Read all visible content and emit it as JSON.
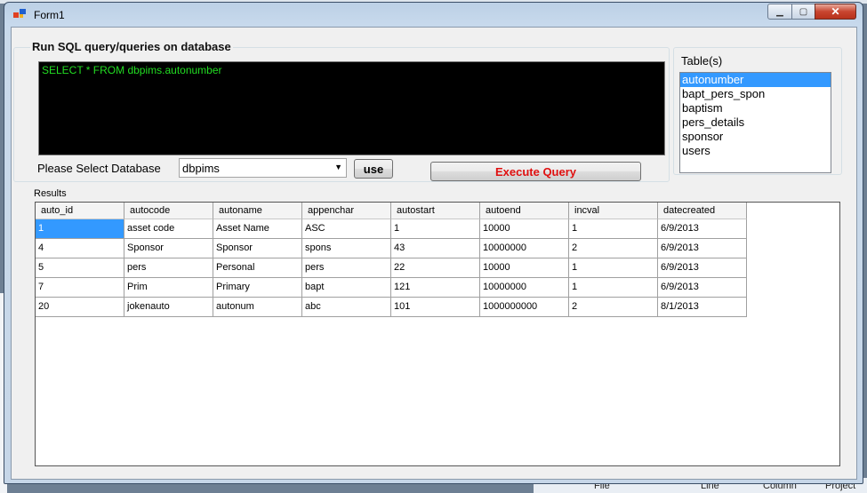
{
  "window": {
    "title": "Form1"
  },
  "sql": {
    "group_title": "Run SQL query/queries on database",
    "query_text": "SELECT * FROM dbpims.autonumber"
  },
  "database": {
    "label": "Please Select Database",
    "selected": "dbpims",
    "use_label": "use"
  },
  "execute_label": "Execute Query",
  "tables": {
    "title": "Table(s)",
    "items": [
      "autonumber",
      "bapt_pers_spon",
      "baptism",
      "pers_details",
      "sponsor",
      "users"
    ],
    "selected_index": 0
  },
  "results": {
    "title": "Results",
    "columns": [
      "auto_id",
      "autocode",
      "autoname",
      "appenchar",
      "autostart",
      "autoend",
      "incval",
      "datecreated"
    ],
    "rows": [
      [
        "1",
        "asset code",
        "Asset Name",
        "ASC",
        "1",
        "10000",
        "1",
        "6/9/2013"
      ],
      [
        "4",
        "Sponsor",
        "Sponsor",
        "spons",
        "43",
        "10000000",
        "2",
        "6/9/2013"
      ],
      [
        "5",
        "pers",
        "Personal",
        "pers",
        "22",
        "10000",
        "1",
        "6/9/2013"
      ],
      [
        "7",
        "Prim",
        "Primary",
        "bapt",
        "121",
        "10000000",
        "1",
        "6/9/2013"
      ],
      [
        "20",
        "jokenauto",
        "autonum",
        "abc",
        "101",
        "1000000000",
        "2",
        "8/1/2013"
      ]
    ]
  },
  "background": {
    "bottom_labels": [
      "File",
      "Line",
      "Column",
      "Project"
    ]
  },
  "colors": {
    "query_text": "#22dd22",
    "execute_text": "#e01010",
    "selection": "#3399ff"
  }
}
